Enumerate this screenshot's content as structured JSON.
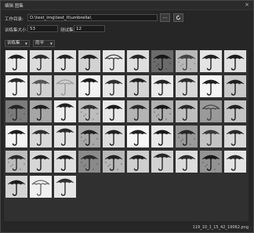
{
  "window": {
    "title": "编辑 图集",
    "close_label": "×"
  },
  "workdir": {
    "label": "工作目录:",
    "value": "D:\\test_img\\test_lt\\umbrella\\",
    "browse_label": "...",
    "refresh_icon": "refresh-icon"
  },
  "training_size": {
    "label": "训练集大小",
    "value": "53"
  },
  "test_size": {
    "label": "测试集大小",
    "value": "12"
  },
  "filters": {
    "set_select": "训练集",
    "label_select": "雨伞"
  },
  "grid": {
    "columns": 10,
    "tiles": [
      {
        "bg": "#e8e8e8",
        "fg": "#202020",
        "var": 0
      },
      {
        "bg": "#dcdcdc",
        "fg": "#2a2a2a",
        "var": 1
      },
      {
        "bg": "#e2e2e2",
        "fg": "#222222",
        "var": 2
      },
      {
        "bg": "#d2d2d2",
        "fg": "#1e1e1e",
        "var": 1
      },
      {
        "bg": "#e6e6e6",
        "fg": "#3a3a3a",
        "var": 3
      },
      {
        "bg": "#dedede",
        "fg": "#252525",
        "var": 0
      },
      {
        "bg": "#7a7a7a",
        "fg": "#1a1a1a",
        "var": 4
      },
      {
        "bg": "#b8b8b8",
        "fg": "#444444",
        "var": 5
      },
      {
        "bg": "#e4e4e4",
        "fg": "#202020",
        "var": 0
      },
      {
        "bg": "#e0e0e0",
        "fg": "#1a1a1a",
        "var": 2
      },
      {
        "bg": "#f0f0f0",
        "fg": "#2a2a2a",
        "var": 6
      },
      {
        "bg": "#d0d0d0",
        "fg": "#555555",
        "var": 1
      },
      {
        "bg": "#cfcfcf",
        "fg": "#9a9a9a",
        "var": 3
      },
      {
        "bg": "#f2f2f2",
        "fg": "#1c1c1c",
        "var": 6
      },
      {
        "bg": "#e6e6e6",
        "fg": "#303030",
        "var": 2
      },
      {
        "bg": "#d4d4d4",
        "fg": "#202020",
        "var": 6
      },
      {
        "bg": "#eaeaea",
        "fg": "#262626",
        "var": 0
      },
      {
        "bg": "#d8d8d8",
        "fg": "#2c2c2c",
        "var": 6
      },
      {
        "bg": "#f4f4f4",
        "fg": "#202020",
        "var": 0
      },
      {
        "bg": "#c8c8c8",
        "fg": "#1e1e1e",
        "var": 1
      },
      {
        "bg": "#8e8e8e",
        "fg": "#2a2a2a",
        "var": 4
      },
      {
        "bg": "#a6a6a6",
        "fg": "#1e1e1e",
        "var": 0
      },
      {
        "bg": "#ececec",
        "fg": "#222222",
        "var": 6
      },
      {
        "bg": "#bdbdbd",
        "fg": "#303030",
        "var": 5
      },
      {
        "bg": "#e8e8e8",
        "fg": "#1a1a1a",
        "var": 0
      },
      {
        "bg": "#b4b4b4",
        "fg": "#282828",
        "var": 1
      },
      {
        "bg": "#c9c9c9",
        "fg": "#1c1c1c",
        "var": 4
      },
      {
        "bg": "#bfbfbf",
        "fg": "#2a2a2a",
        "var": 1
      },
      {
        "bg": "#9a9a9a",
        "fg": "#444444",
        "var": 3
      },
      {
        "bg": "#c4c4c4",
        "fg": "#202020",
        "var": 0
      },
      {
        "bg": "#f4f4f4",
        "fg": "#1e1e1e",
        "var": 0
      },
      {
        "bg": "#d8d8d8",
        "fg": "#303030",
        "var": 1
      },
      {
        "bg": "#e2e2e2",
        "fg": "#2a2a2a",
        "var": 6
      },
      {
        "bg": "#a8a8a8",
        "fg": "#202020",
        "var": 5
      },
      {
        "bg": "#dcdcdc",
        "fg": "#202020",
        "var": 2
      },
      {
        "bg": "#f6f6f6",
        "fg": "#222222",
        "var": 0
      },
      {
        "bg": "#e8e8e8",
        "fg": "#1a1a1a",
        "var": 0
      },
      {
        "bg": "#b0b0b0",
        "fg": "#2c2c2c",
        "var": 4
      },
      {
        "bg": "#c2c2c2",
        "fg": "#3a3a3a",
        "var": 1
      },
      {
        "bg": "#d8d8d8",
        "fg": "#282828",
        "var": 0
      },
      {
        "bg": "#bdbdbd",
        "fg": "#2a2a2a",
        "var": 5
      },
      {
        "bg": "#d6d6d6",
        "fg": "#1e1e1e",
        "var": 1
      },
      {
        "bg": "#e0e0e0",
        "fg": "#202020",
        "var": 2
      },
      {
        "bg": "#9e9e9e",
        "fg": "#303030",
        "var": 4
      },
      {
        "bg": "#b8b8b8",
        "fg": "#222222",
        "var": 5
      },
      {
        "bg": "#cfcfcf",
        "fg": "#202020",
        "var": 1
      },
      {
        "bg": "#d2d2d2",
        "fg": "#262626",
        "var": 6
      },
      {
        "bg": "#dcdcdc",
        "fg": "#2c2c2c",
        "var": 0
      },
      {
        "bg": "#a8a8a8",
        "fg": "#1c1c1c",
        "var": 4
      },
      {
        "bg": "#e4e4e4",
        "fg": "#2a2a2a",
        "var": 2
      },
      {
        "bg": "#d4d4d4",
        "fg": "#1c1c1c",
        "var": 0
      },
      {
        "bg": "#f0f0f0",
        "fg": "#6a6a6a",
        "var": 3
      },
      {
        "bg": "#e6e6e6",
        "fg": "#303030",
        "var": 6
      }
    ]
  },
  "status": {
    "filename": "119_10_1_15_42_19062.png",
    "grip_icon": "resize-grip-icon"
  }
}
